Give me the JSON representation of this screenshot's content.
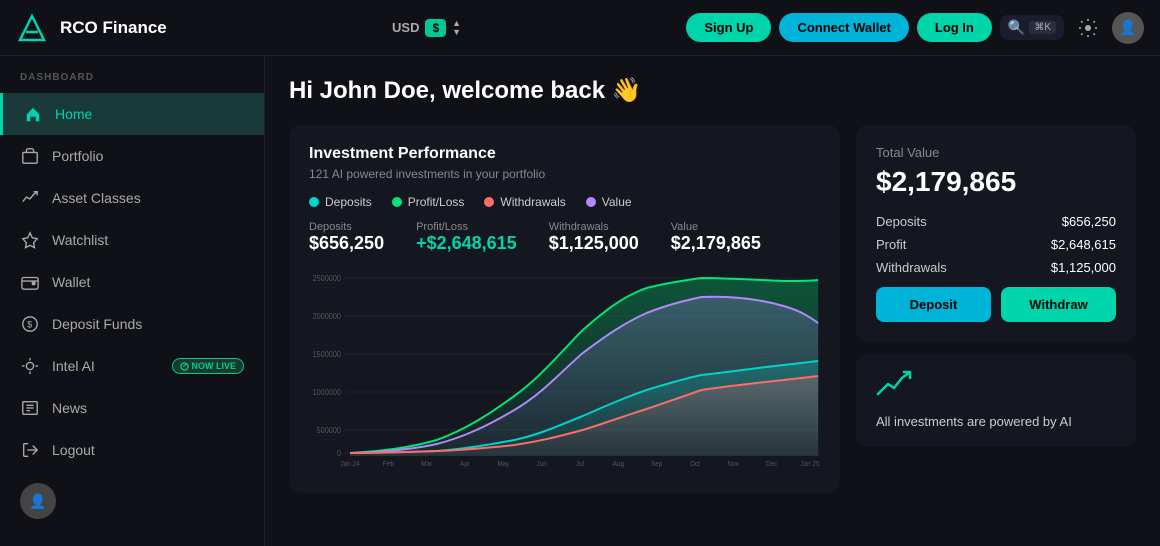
{
  "brand": {
    "name": "RCO Finance",
    "logo_text": "R"
  },
  "header": {
    "currency_label": "USD",
    "currency_badge": "$",
    "signup_label": "Sign Up",
    "connect_wallet_label": "Connect Wallet",
    "login_label": "Log In",
    "search_placeholder": "Search...",
    "kbd_shortcut": "⌘K"
  },
  "sidebar": {
    "section_label": "DASHBOARD",
    "items": [
      {
        "id": "home",
        "label": "Home",
        "icon": "🏠",
        "active": true
      },
      {
        "id": "portfolio",
        "label": "Portfolio",
        "icon": "💼",
        "active": false
      },
      {
        "id": "asset-classes",
        "label": "Asset Classes",
        "icon": "📊",
        "active": false
      },
      {
        "id": "watchlist",
        "label": "Watchlist",
        "icon": "⭐",
        "active": false
      },
      {
        "id": "wallet",
        "label": "Wallet",
        "icon": "🔒",
        "active": false
      },
      {
        "id": "deposit-funds",
        "label": "Deposit Funds",
        "icon": "💵",
        "active": false
      },
      {
        "id": "intel-ai",
        "label": "Intel AI",
        "icon": "🤖",
        "active": false,
        "badge": "NOW LIVE"
      },
      {
        "id": "news",
        "label": "News",
        "icon": "📰",
        "active": false
      },
      {
        "id": "logout",
        "label": "Logout",
        "icon": "↗",
        "active": false
      }
    ]
  },
  "main": {
    "welcome_text": "Hi John Doe, welcome back 👋",
    "chart": {
      "title": "Investment Performance",
      "subtitle": "121 AI powered investments in your portfolio",
      "legend": [
        {
          "label": "Deposits",
          "color": "#00d4c8"
        },
        {
          "label": "Profit/Loss",
          "color": "#00e676"
        },
        {
          "label": "Withdrawals",
          "color": "#ff6b6b"
        },
        {
          "label": "Value",
          "color": "#b388ff"
        }
      ],
      "values": [
        {
          "label": "Deposits",
          "value": "$656,250",
          "class": ""
        },
        {
          "label": "Profit/Loss",
          "value": "+$2,648,615",
          "class": "positive"
        },
        {
          "label": "Withdrawals",
          "value": "$1,125,000",
          "class": ""
        },
        {
          "label": "Value",
          "value": "$2,179,865",
          "class": ""
        }
      ],
      "x_labels": [
        "Jan 24",
        "Feb",
        "Mar",
        "Apr",
        "May",
        "Jun",
        "Jul",
        "Aug",
        "Sep",
        "Oct",
        "Nov",
        "Dec",
        "Jan 25"
      ],
      "y_labels": [
        "0",
        "500000",
        "1000000",
        "1500000",
        "2000000",
        "2500000"
      ]
    },
    "total_value": {
      "label": "Total Value",
      "amount": "$2,179,865",
      "rows": [
        {
          "label": "Deposits",
          "value": "$656,250"
        },
        {
          "label": "Profit",
          "value": "$2,648,615"
        },
        {
          "label": "Withdrawals",
          "value": "$1,125,000"
        }
      ],
      "deposit_btn": "Deposit",
      "withdraw_btn": "Withdraw"
    },
    "ai_card": {
      "icon": "📈",
      "text": "All investments are powered by AI"
    }
  }
}
